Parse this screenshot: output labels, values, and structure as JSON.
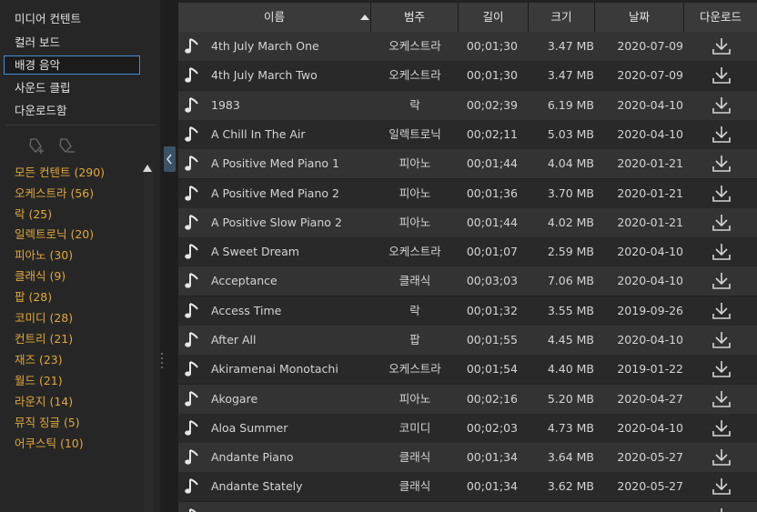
{
  "sidebar": {
    "nav": [
      "미디어 컨텐트",
      "컬러 보드",
      "배경 음악",
      "사운드 클립",
      "다운로드함"
    ],
    "selected_index": 2,
    "categories": [
      "모든 컨텐트 (290)",
      "오케스트라 (56)",
      "락 (25)",
      "일렉트로닉 (20)",
      "피아노 (30)",
      "클래식 (9)",
      "팝 (28)",
      "코미디 (28)",
      "컨트리 (21)",
      "재즈 (23)",
      "월드 (21)",
      "라운지 (14)",
      "뮤직 징글 (5)",
      "어쿠스틱 (10)"
    ]
  },
  "table": {
    "headers": {
      "name": "이름",
      "category": "범주",
      "length": "길이",
      "size": "크기",
      "date": "날짜",
      "download": "다운로드"
    },
    "sort": "ascending",
    "rows": [
      {
        "name": "4th July March One",
        "category": "오케스트라",
        "length": "00;01;30",
        "size": "3.47 MB",
        "date": "2020-07-09"
      },
      {
        "name": "4th July March Two",
        "category": "오케스트라",
        "length": "00;01;30",
        "size": "3.47 MB",
        "date": "2020-07-09"
      },
      {
        "name": "1983",
        "category": "락",
        "length": "00;02;39",
        "size": "6.19 MB",
        "date": "2020-04-10"
      },
      {
        "name": "A Chill In The Air",
        "category": "일렉트로닉",
        "length": "00;02;11",
        "size": "5.03 MB",
        "date": "2020-04-10"
      },
      {
        "name": "A Positive Med Piano 1",
        "category": "피아노",
        "length": "00;01;44",
        "size": "4.04 MB",
        "date": "2020-01-21"
      },
      {
        "name": "A Positive Med Piano 2",
        "category": "피아노",
        "length": "00;01;36",
        "size": "3.70 MB",
        "date": "2020-01-21"
      },
      {
        "name": "A Positive Slow Piano 2",
        "category": "피아노",
        "length": "00;01;44",
        "size": "4.02 MB",
        "date": "2020-01-21"
      },
      {
        "name": "A Sweet Dream",
        "category": "오케스트라",
        "length": "00;01;07",
        "size": "2.59 MB",
        "date": "2020-04-10"
      },
      {
        "name": "Acceptance",
        "category": "클래식",
        "length": "00;03;03",
        "size": "7.06 MB",
        "date": "2020-04-10"
      },
      {
        "name": "Access Time",
        "category": "락",
        "length": "00;01;32",
        "size": "3.55 MB",
        "date": "2019-09-26"
      },
      {
        "name": "After All",
        "category": "팝",
        "length": "00;01;55",
        "size": "4.45 MB",
        "date": "2020-04-10"
      },
      {
        "name": "Akiramenai Monotachi",
        "category": "오케스트라",
        "length": "00;01;54",
        "size": "4.40 MB",
        "date": "2019-01-22"
      },
      {
        "name": "Akogare",
        "category": "피아노",
        "length": "00;02;16",
        "size": "5.20 MB",
        "date": "2020-04-27"
      },
      {
        "name": "Aloa Summer",
        "category": "코미디",
        "length": "00;02;03",
        "size": "4.73 MB",
        "date": "2020-04-10"
      },
      {
        "name": "Andante Piano",
        "category": "클래식",
        "length": "00;01;34",
        "size": "3.64 MB",
        "date": "2020-05-27"
      },
      {
        "name": "Andante Stately",
        "category": "클래식",
        "length": "00;01;34",
        "size": "3.62 MB",
        "date": "2020-05-27"
      },
      {
        "name": "",
        "category": "",
        "length": "",
        "size": "",
        "date": ""
      }
    ]
  },
  "icons": {
    "row_icon": "music-note-icon",
    "download": "download-icon",
    "collapse": "chevron-left-icon",
    "tag_add": "tag-add-icon",
    "tag_remove": "tag-remove-icon"
  },
  "colors": {
    "accent": "#3f8ed8",
    "category_text": "#e0a83a",
    "row_odd": "#333333",
    "row_even": "#292929",
    "header_bg": "#3a3a3a"
  }
}
